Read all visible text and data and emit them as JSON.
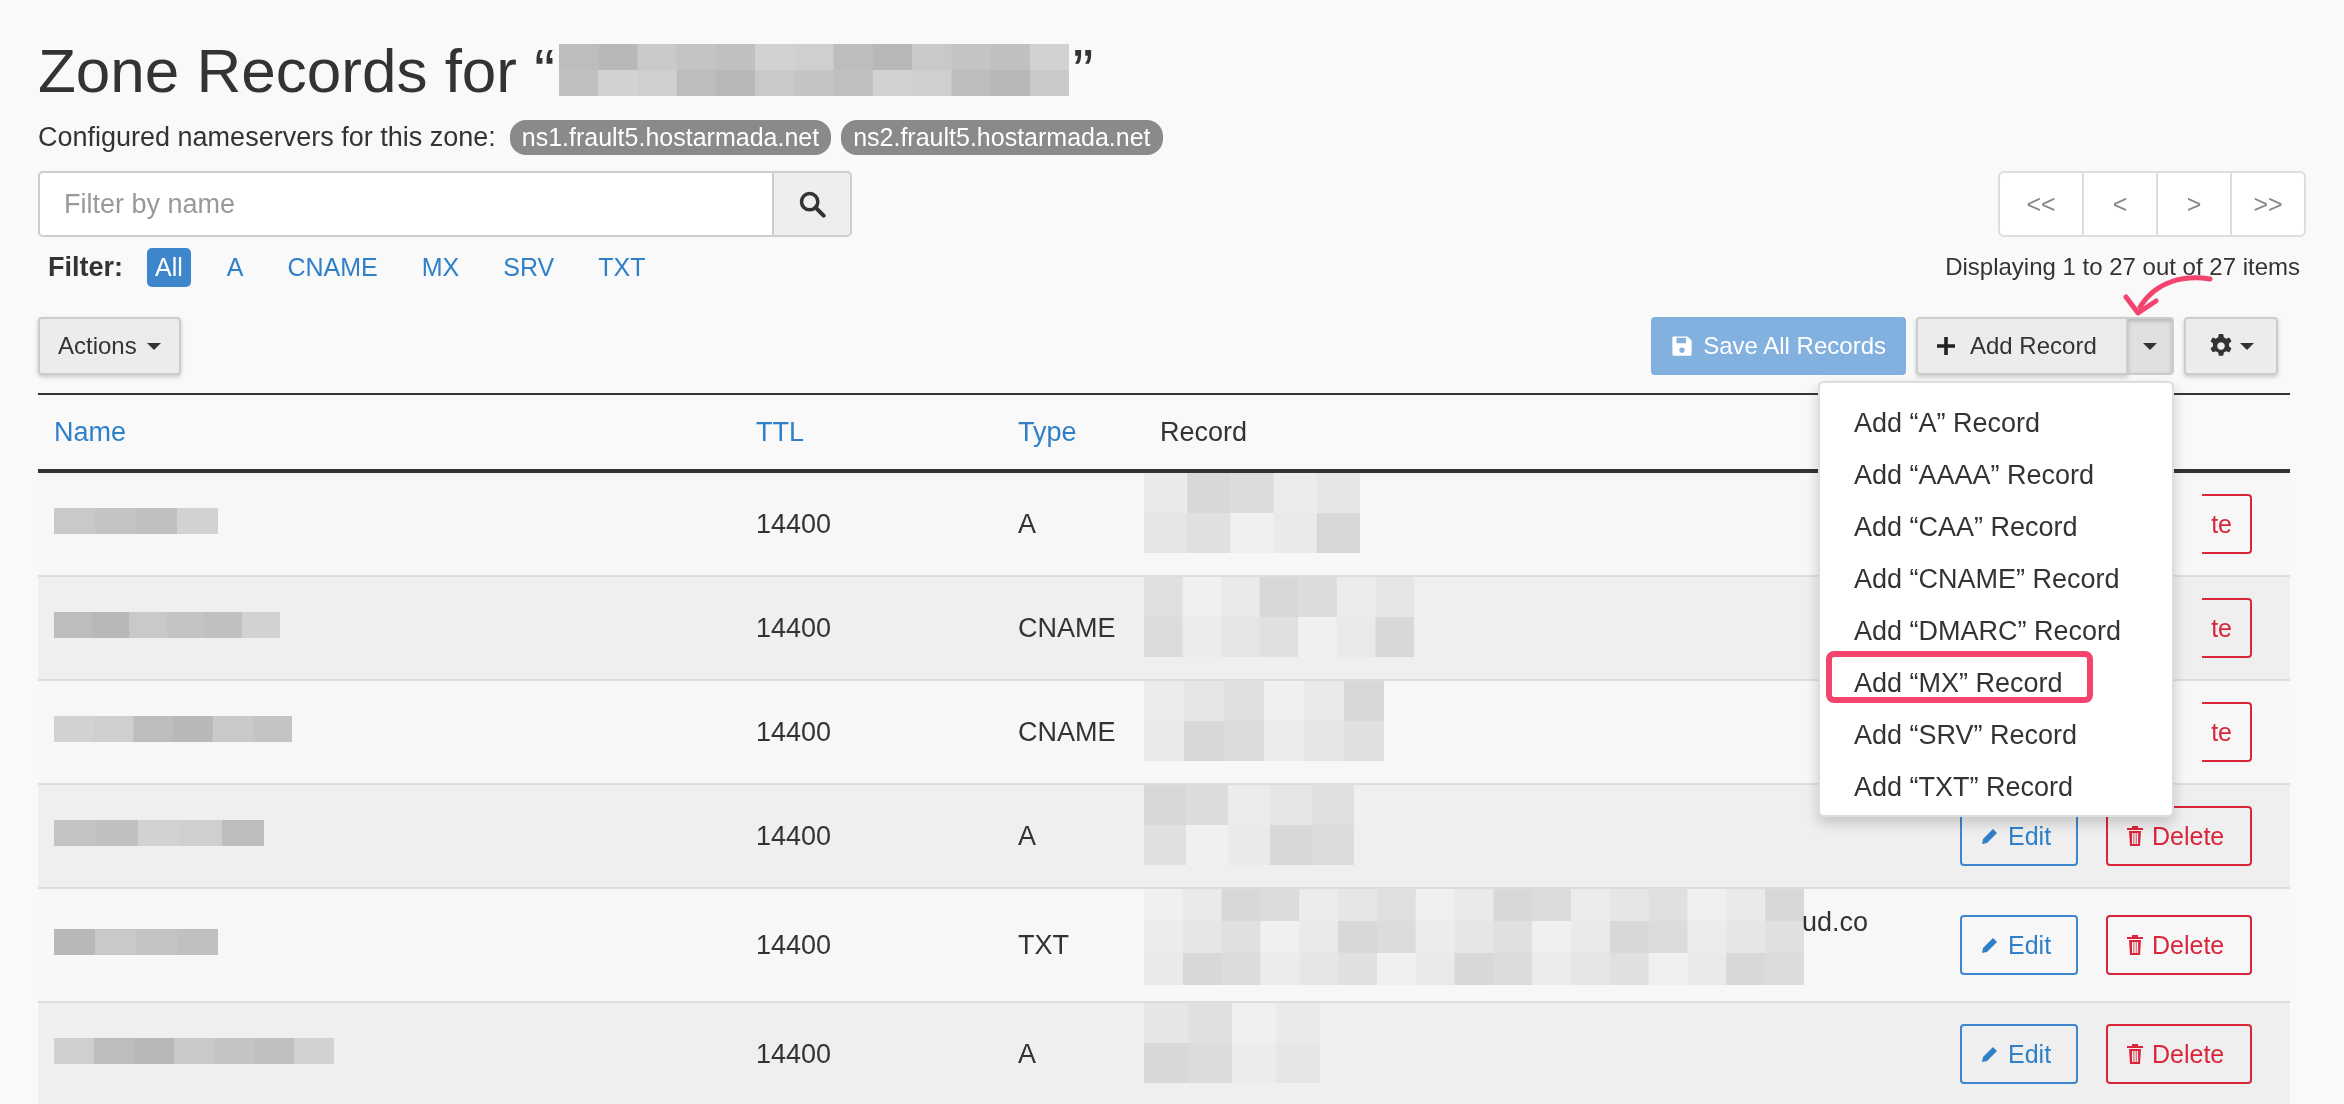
{
  "page": {
    "title": "Zone Records for “",
    "title_end": "”",
    "nameservers_label": "Configured nameservers for this zone:",
    "nameservers": [
      "ns1.frault5.hostarmada.net",
      "ns2.frault5.hostarmada.net"
    ]
  },
  "search": {
    "placeholder": "Filter by name"
  },
  "filter": {
    "label": "Filter:",
    "options": [
      {
        "label": "All",
        "selected": true
      },
      {
        "label": "A",
        "selected": false
      },
      {
        "label": "CNAME",
        "selected": false
      },
      {
        "label": "MX",
        "selected": false
      },
      {
        "label": "SRV",
        "selected": false
      },
      {
        "label": "TXT",
        "selected": false
      }
    ]
  },
  "pagination": {
    "buttons": [
      "<<",
      "<",
      ">",
      ">>"
    ],
    "summary": "Displaying 1 to 27 out of 27 items"
  },
  "toolbar": {
    "actions": "Actions",
    "save": "Save All Records",
    "save_disabled": true,
    "add": "Add Record"
  },
  "add_menu": {
    "expanded": true,
    "items": [
      {
        "label": "Add “A” Record",
        "highlighted": false
      },
      {
        "label": "Add “AAAA” Record",
        "highlighted": false
      },
      {
        "label": "Add “CAA” Record",
        "highlighted": false
      },
      {
        "label": "Add “CNAME” Record",
        "highlighted": false
      },
      {
        "label": "Add “DMARC” Record",
        "highlighted": false
      },
      {
        "label": "Add “MX” Record",
        "highlighted": true
      },
      {
        "label": "Add “SRV” Record",
        "highlighted": false
      },
      {
        "label": "Add “TXT” Record",
        "highlighted": false
      }
    ]
  },
  "table": {
    "columns": [
      {
        "label": "Name",
        "sortable": true
      },
      {
        "label": "TTL",
        "sortable": true
      },
      {
        "label": "Type",
        "sortable": true
      },
      {
        "label": "Record",
        "sortable": false
      }
    ],
    "rows": [
      {
        "ttl": "14400",
        "type": "A",
        "delete": "te"
      },
      {
        "ttl": "14400",
        "type": "CNAME",
        "delete": "te"
      },
      {
        "ttl": "14400",
        "type": "CNAME",
        "delete": "te"
      },
      {
        "ttl": "14400",
        "type": "A",
        "edit": "Edit",
        "delete": "Delete"
      },
      {
        "ttl": "14400",
        "type": "TXT",
        "record": "ud.co",
        "edit": "Edit",
        "delete": "Delete"
      },
      {
        "ttl": "14400",
        "type": "A",
        "edit": "Edit",
        "delete": "Delete"
      }
    ]
  }
}
